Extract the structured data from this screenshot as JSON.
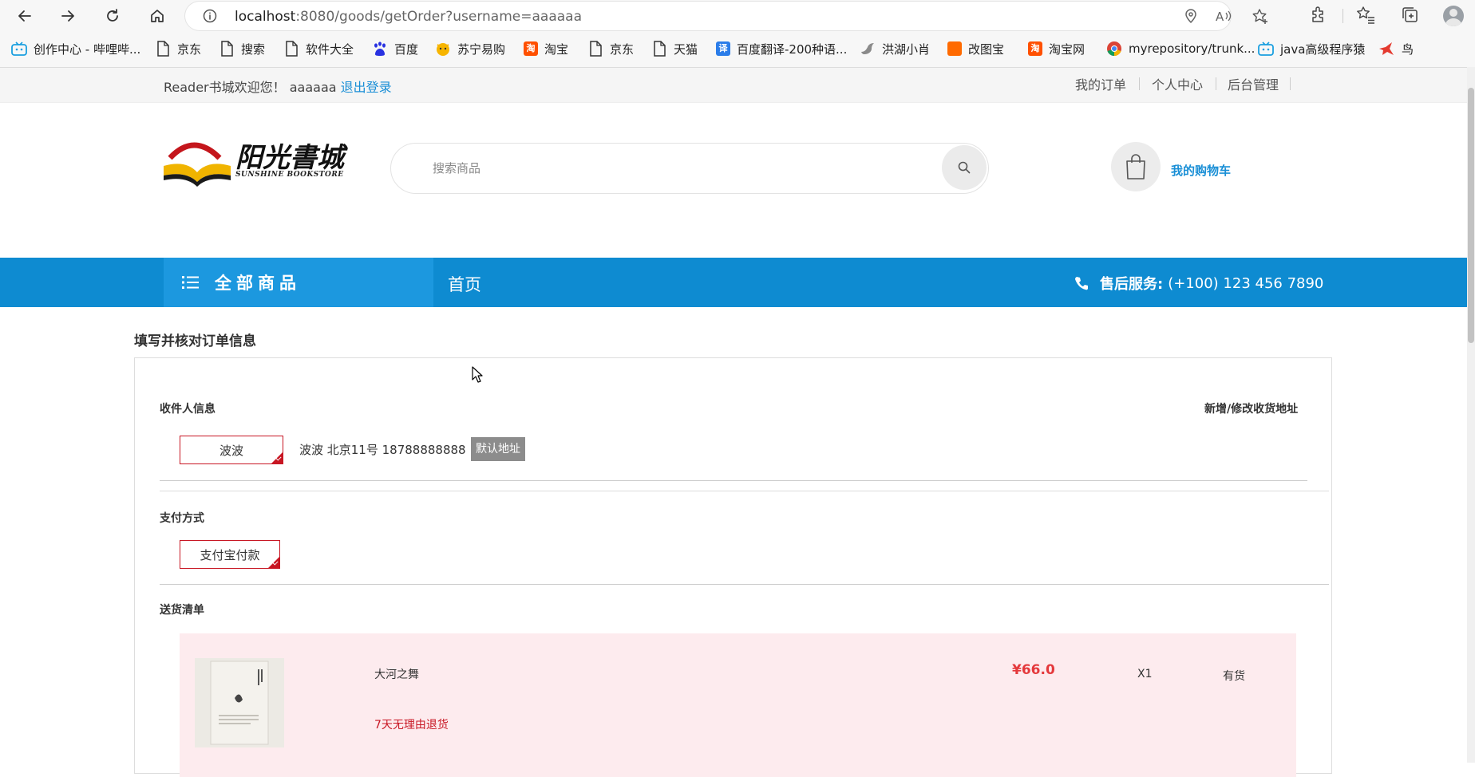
{
  "browser": {
    "url_host": "localhost",
    "url_rest": ":8080/goods/getOrder?username=aaaaaa"
  },
  "bookmarks": [
    {
      "label": "创作中心 - 哔哩哔...",
      "icon": "bilibili-icon"
    },
    {
      "label": "京东",
      "icon": "page-icon"
    },
    {
      "label": "搜索",
      "icon": "page-icon"
    },
    {
      "label": "软件大全",
      "icon": "page-icon"
    },
    {
      "label": "百度",
      "icon": "baidu-icon"
    },
    {
      "label": "苏宁易购",
      "icon": "suning-icon"
    },
    {
      "label": "淘宝",
      "icon": "taobao-icon"
    },
    {
      "label": "京东",
      "icon": "page-icon"
    },
    {
      "label": "天猫",
      "icon": "page-icon"
    },
    {
      "label": "百度翻译-200种语...",
      "icon": "translate-icon"
    },
    {
      "label": "洪湖小肖",
      "icon": "bird-icon"
    },
    {
      "label": "改图宝",
      "icon": "gaitubao-icon"
    },
    {
      "label": "淘宝网",
      "icon": "taobao-icon"
    },
    {
      "label": "myrepository/trunk...",
      "icon": "chrome-icon"
    },
    {
      "label": "java高级程序猿",
      "icon": "bilibili-icon"
    },
    {
      "label": "鸟",
      "icon": "bird-icon"
    }
  ],
  "topbar": {
    "welcome_prefix": "Reader书城欢迎您！",
    "username": "aaaaaa",
    "logout": "退出登录",
    "links": [
      "我的订单",
      "个人中心",
      "后台管理"
    ]
  },
  "header": {
    "logo_text": "阳光書城",
    "logo_sub": "SUNSHINE BOOKSTORE",
    "search_placeholder": "搜索商品",
    "cart_label": "我的购物车"
  },
  "nav": {
    "all_goods": "全部商品",
    "home": "首页",
    "service_label": "售后服务:",
    "service_phone": "(+100) 123 456 7890"
  },
  "order": {
    "title": "填写并核对订单信息",
    "receiver_label": "收件人信息",
    "edit_address": "新增/修改收货地址",
    "receiver_name": "波波",
    "address_detail": "波波 北京11号 18788888888",
    "default_badge": "默认地址",
    "payment_label": "支付方式",
    "payment_method": "支付宝付款",
    "delivery_label": "送货清单",
    "item": {
      "name": "大河之舞",
      "promise": "7天无理由退货",
      "price": "¥66.0",
      "qty": "X1",
      "stock": "有货"
    }
  }
}
